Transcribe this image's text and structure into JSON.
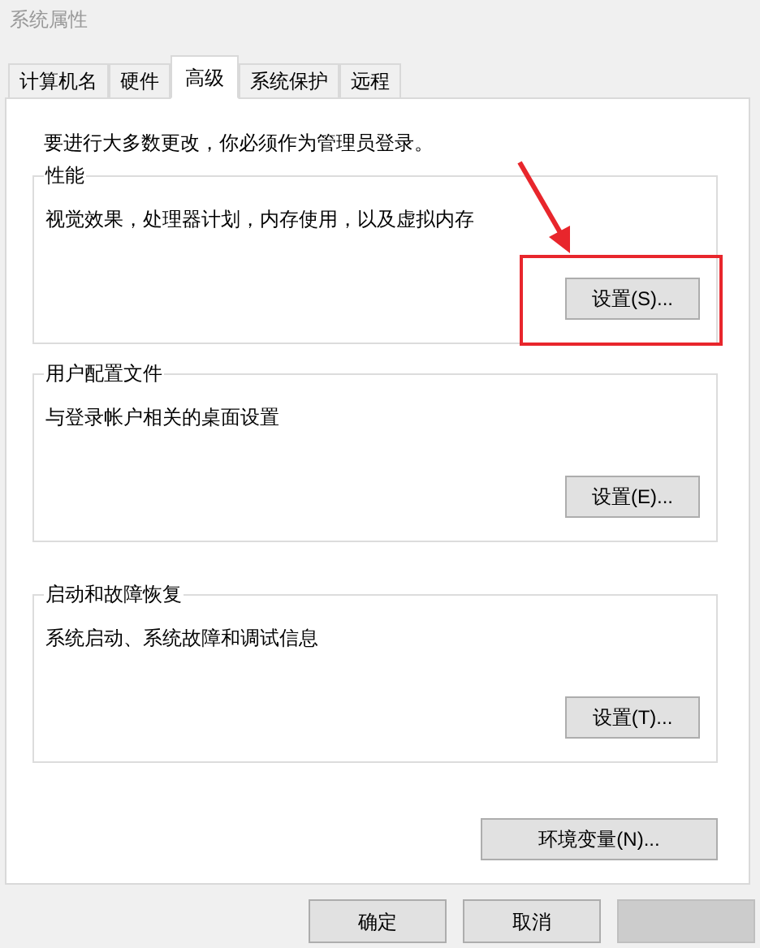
{
  "window": {
    "title": "系统属性"
  },
  "tabs": [
    {
      "label": "计算机名",
      "selected": false
    },
    {
      "label": "硬件",
      "selected": false
    },
    {
      "label": "高级",
      "selected": true
    },
    {
      "label": "系统保护",
      "selected": false
    },
    {
      "label": "远程",
      "selected": false
    }
  ],
  "notice": "要进行大多数更改，你必须作为管理员登录。",
  "groups": [
    {
      "title": "性能",
      "description": "视觉效果，处理器计划，内存使用，以及虚拟内存",
      "button": "设置(S)...",
      "highlighted": true
    },
    {
      "title": "用户配置文件",
      "description": "与登录帐户相关的桌面设置",
      "button": "设置(E)...",
      "highlighted": false
    },
    {
      "title": "启动和故障恢复",
      "description": "系统启动、系统故障和调试信息",
      "button": "设置(T)...",
      "highlighted": false
    }
  ],
  "environment_button": "环境变量(N)...",
  "dialog_buttons": [
    {
      "label": "确定",
      "disabled": false
    },
    {
      "label": "取消",
      "disabled": false
    },
    {
      "disabled": true
    }
  ]
}
